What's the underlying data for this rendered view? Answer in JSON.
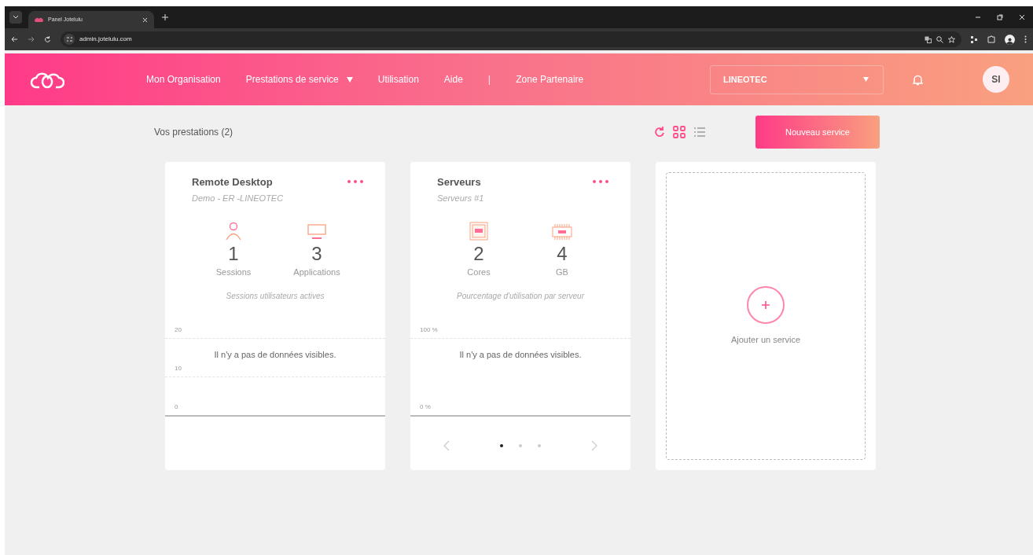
{
  "browser": {
    "tab": {
      "title": "Panel Jotelulu"
    },
    "address": "admin.jotelulu.com"
  },
  "nav": {
    "items": [
      {
        "label": "Mon Organisation",
        "kind": "link"
      },
      {
        "label": "Prestations de service",
        "kind": "dropdown"
      },
      {
        "label": "Utilisation",
        "kind": "link"
      },
      {
        "label": "Aide",
        "kind": "link"
      },
      {
        "label": "|",
        "kind": "separator"
      },
      {
        "label": "Zone Partenaire",
        "kind": "link"
      }
    ],
    "organization_select": {
      "value": "LINEOTEC"
    },
    "avatar": "SI"
  },
  "toolbar": {
    "heading": "Vos prestations (2)",
    "views": [
      {
        "kind": "grid",
        "selected": true
      },
      {
        "kind": "list",
        "selected": false
      }
    ],
    "new_button": "Nouveau service"
  },
  "cards": [
    {
      "title": "Remote Desktop",
      "subtitle": "Demo - ER -LINEOTEC",
      "metrics": [
        {
          "kind": "user",
          "value": "1",
          "label": "Sessions"
        },
        {
          "kind": "monitor",
          "value": "3",
          "label": "Applications"
        }
      ],
      "caption": "Sessions utilisateurs actives",
      "axis_labels": [
        "20",
        "10",
        "0"
      ],
      "empty_message": "Il n'y a pas de données visibles."
    },
    {
      "title": "Serveurs",
      "subtitle": "Serveurs #1",
      "metrics": [
        {
          "kind": "cpu",
          "value": "2",
          "label": "Cores"
        },
        {
          "kind": "ram",
          "value": "4",
          "label": "GB"
        }
      ],
      "caption": "Pourcentage d'utilisation par serveur",
      "axis_labels": [
        "100 %",
        "0 %"
      ],
      "empty_message": "Il n'y a pas de données visibles.",
      "carousel": [
        {
          "selected": true
        },
        {
          "selected": false
        },
        {
          "selected": false
        }
      ]
    }
  ],
  "add_card": {
    "label": "Ajouter un service"
  }
}
